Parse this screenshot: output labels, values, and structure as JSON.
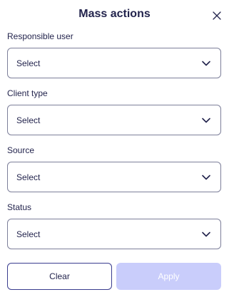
{
  "dialog": {
    "title": "Mass actions",
    "close_icon": "close-icon"
  },
  "fields": [
    {
      "label": "Responsible user",
      "value": "Select"
    },
    {
      "label": "Client type",
      "value": "Select"
    },
    {
      "label": "Source",
      "value": "Select"
    },
    {
      "label": "Status",
      "value": "Select"
    }
  ],
  "actions": {
    "clear_label": "Clear",
    "apply_label": "Apply",
    "apply_disabled": true
  },
  "colors": {
    "text": "#23244d",
    "border": "#7d7f9a",
    "primary_outline": "#3a3d8f",
    "apply_disabled_bg": "#c9cdfb"
  }
}
